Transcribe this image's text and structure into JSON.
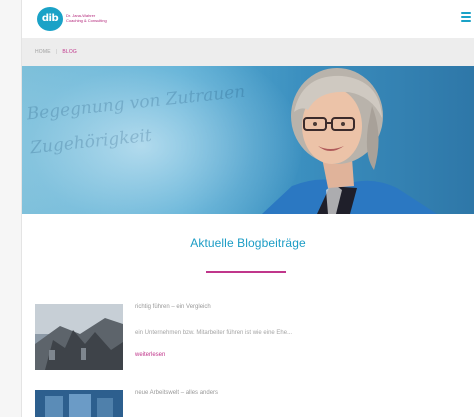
{
  "logo": {
    "mark": "dib",
    "line1": "Dr. Jana-Wahrer",
    "line2": "Coaching & Consulting"
  },
  "breadcrumb": {
    "home": "HOME",
    "separator": "|",
    "current": "BLOG"
  },
  "hero": {
    "background_text_line1": "Begegnung von Zutrauen",
    "background_text_line2": "Zugehörigkeit"
  },
  "section": {
    "title": "Aktuelle Blogbeiträge"
  },
  "posts": [
    {
      "title": "richtig führen – ein Vergleich",
      "excerpt": "ein Unternehmen bzw. Mitarbeiter führen ist wie eine Ehe...",
      "more": "weiterlesen"
    },
    {
      "title": "neue Arbeitswelt – alles anders"
    }
  ],
  "colors": {
    "accent_blue": "#1aa2c7",
    "accent_magenta": "#c0368b",
    "breadcrumb_bg": "#ededed"
  },
  "icons": {
    "menu": "hamburger-menu-icon"
  }
}
